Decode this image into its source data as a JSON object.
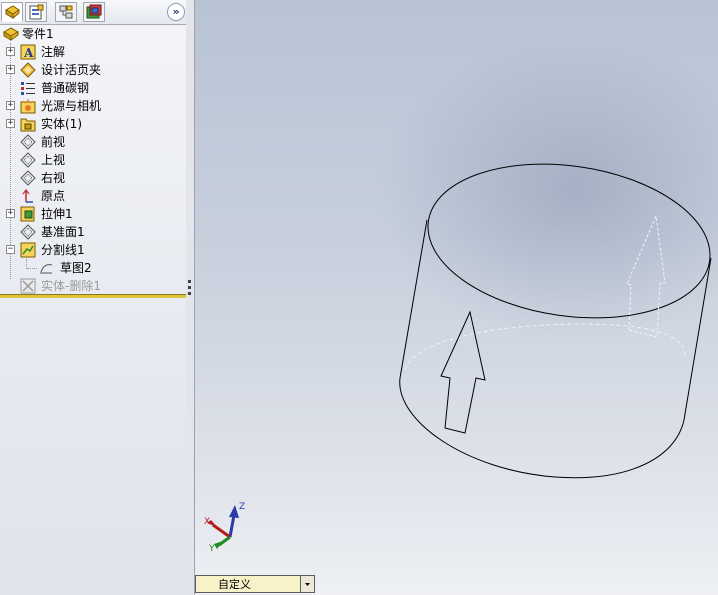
{
  "panel_tabs": [
    {
      "name": "featuremanager-tab",
      "icon": "feature-tree-icon"
    },
    {
      "name": "propertymanager-tab",
      "icon": "property-manager-icon"
    },
    {
      "name": "configurationmanager-tab",
      "icon": "configuration-icon"
    },
    {
      "name": "display-manager-tab",
      "icon": "appearance-icon"
    }
  ],
  "expand_label": "»",
  "tree": {
    "root": "零件1",
    "items": [
      {
        "label": "注解",
        "icon": "annotations-icon",
        "expandable": true
      },
      {
        "label": "设计活页夹",
        "icon": "design-binder-icon",
        "expandable": true
      },
      {
        "label": "普通碳钢",
        "icon": "material-icon",
        "expandable": false
      },
      {
        "label": "光源与相机",
        "icon": "lights-cameras-icon",
        "expandable": true
      },
      {
        "label": "实体(1)",
        "icon": "solid-bodies-icon",
        "expandable": true
      },
      {
        "label": "前视",
        "icon": "plane-icon",
        "expandable": false
      },
      {
        "label": "上视",
        "icon": "plane-icon",
        "expandable": false
      },
      {
        "label": "右视",
        "icon": "plane-icon",
        "expandable": false
      },
      {
        "label": "原点",
        "icon": "origin-icon",
        "expandable": false
      },
      {
        "label": "拉伸1",
        "icon": "extrude-icon",
        "expandable": true
      },
      {
        "label": "基准面1",
        "icon": "plane-icon",
        "expandable": false
      },
      {
        "label": "分割线1",
        "icon": "split-line-icon",
        "expandable": true,
        "expanded": true
      },
      {
        "label": "草图2",
        "icon": "sketch-icon",
        "child": true
      },
      {
        "label": "实体-删除1",
        "icon": "delete-body-icon",
        "disabled": true
      }
    ]
  },
  "triad": {
    "x": "X",
    "y": "Y",
    "z": "Z"
  },
  "view_selector": {
    "value": "自定义"
  }
}
